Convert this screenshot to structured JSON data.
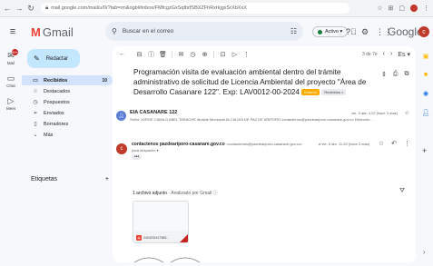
{
  "browser": {
    "url": "mail.google.com/mail/u/0/?tab=rm&ogbl#inbox/FMfcgzGxSqtbrfSBXZFhRxrkjgxSrXbXxX",
    "back_icon": "back-arrow-icon",
    "forward_icon": "forward-arrow-icon",
    "reload_icon": "reload-icon"
  },
  "header": {
    "app_name": "Gmail",
    "search_placeholder": "Buscar en el correo",
    "status": "Activo",
    "google_word": "Google",
    "user_initial": "c"
  },
  "rail": {
    "mail_label": "Mail",
    "mail_badge": "99+",
    "chat_label": "Chat",
    "meet_label": "Meet"
  },
  "sidebar": {
    "compose_label": "Redactar",
    "folders": [
      {
        "label": "Recibidos",
        "count": "10",
        "icon": "inbox-icon"
      },
      {
        "label": "Destacados",
        "count": "",
        "icon": "star-icon"
      },
      {
        "label": "Pospuestos",
        "count": "",
        "icon": "clock-icon"
      },
      {
        "label": "Enviados",
        "count": "",
        "icon": "send-icon"
      },
      {
        "label": "Borradores",
        "count": "",
        "icon": "draft-icon"
      },
      {
        "label": "Más",
        "count": "",
        "icon": "chevron-down-icon"
      }
    ],
    "labels_title": "Etiquetas",
    "labels_add": "+"
  },
  "toolbar": {
    "pager_text": "3 de 7e"
  },
  "email": {
    "subject": "Programación visita de evaluación ambiental dentro del trámite administrativo de solicitud de Licencia Ambiental del proyecto \"Área de Desarrollo Casanare 122\". Exp: LAV0012-00-2024",
    "tag_primary": "Externo",
    "tag_secondary": "Recibidos ×",
    "messages": [
      {
        "sender": "EIA CASANARE 122",
        "snippet": "Señor JORGE CAMILO ABEL TARACHE Alcalde Municipal ALCALDÍA DE PAZ DE ARIPORO contactenos@pazdeariporo-casanare.gov.co Dirección...",
        "date": "vie, 5 abr, 4:22 (hace 3 días)"
      },
      {
        "sender": "contactenos pazdeariporo-casanare.gov.co",
        "email": "<contactenos@pazdeariporo-casanare.gov.co>",
        "to": "para despacho ▾",
        "date": "vie, 5 abr, 11:20 (hace 3 días)"
      }
    ],
    "attachment_header": "1 archivo adjunto",
    "attachment_scan": " · Analizado por Gmail ⓘ",
    "attachment_name": "0404202417565..."
  }
}
